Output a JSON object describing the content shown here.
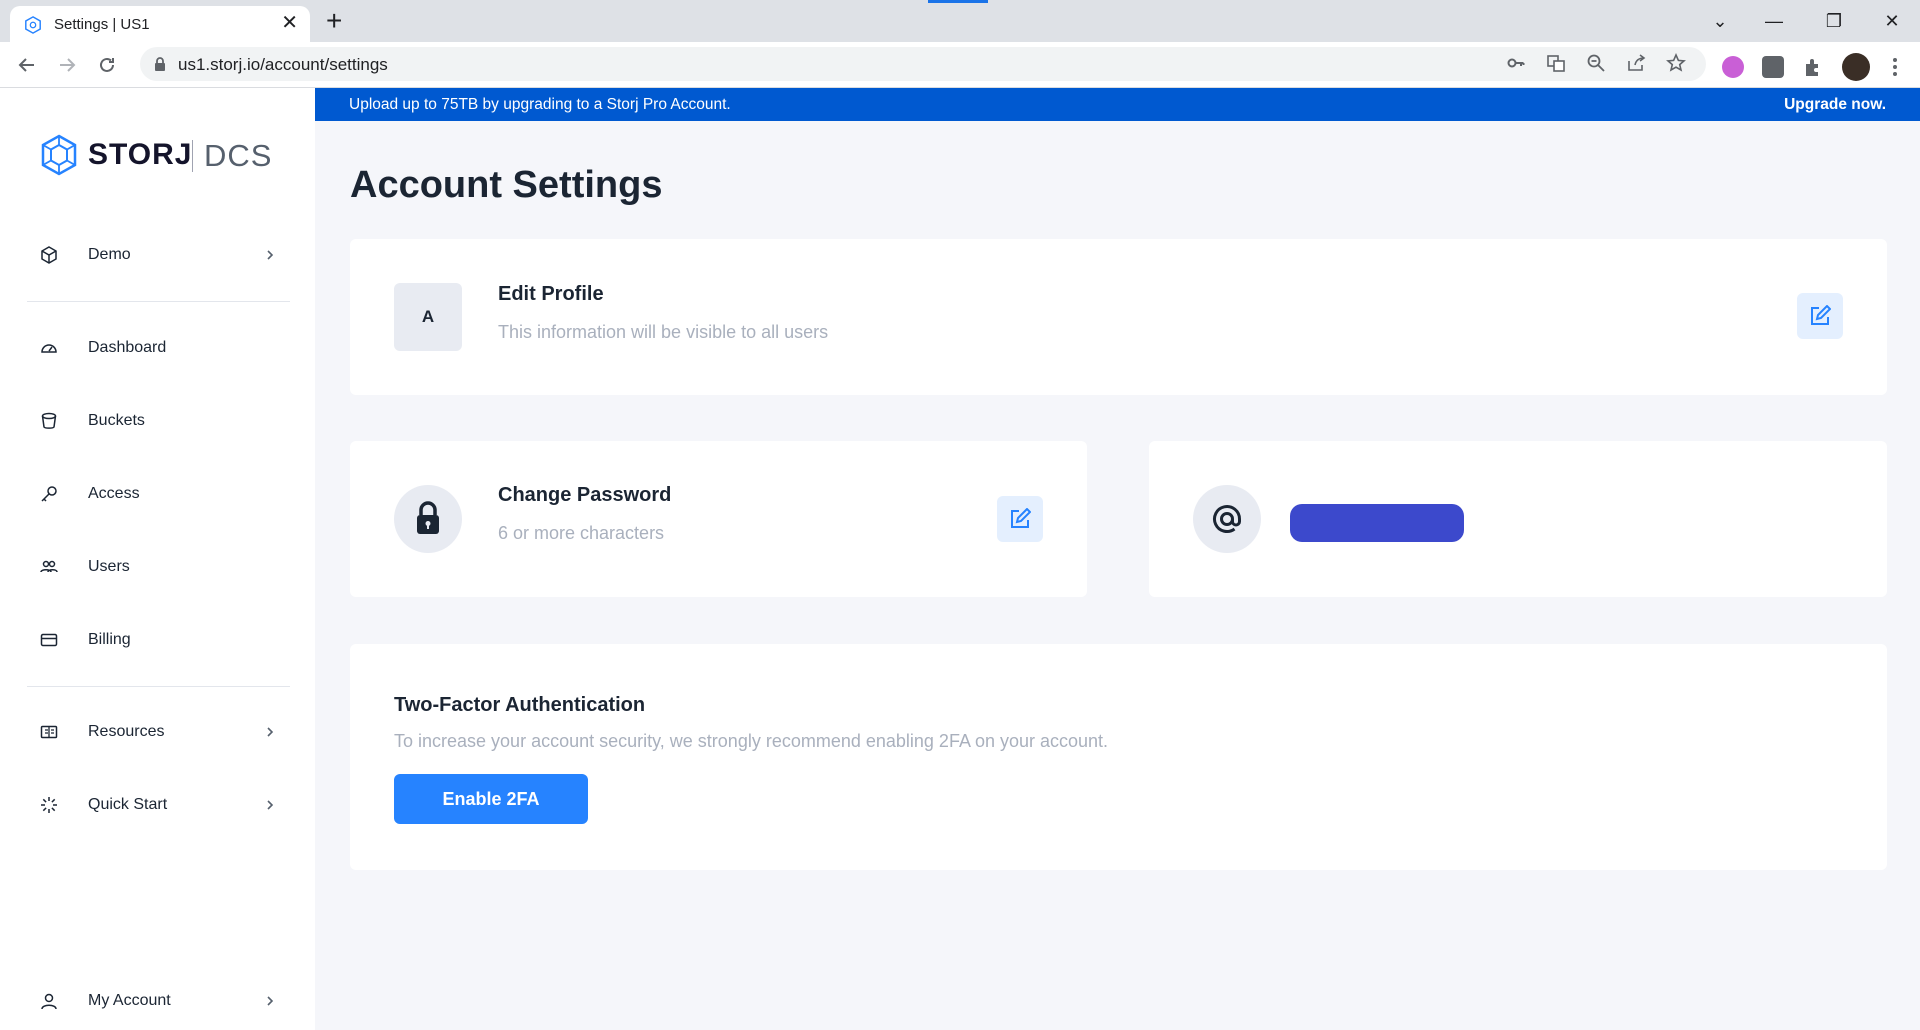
{
  "browser": {
    "tab_title": "Settings | US1",
    "tab_close": "✕",
    "new_tab": "+",
    "url": "us1.storj.io/account/settings",
    "window_controls": {
      "dropdown": "⌄",
      "minimize": "—",
      "restore": "❐",
      "close": "✕"
    }
  },
  "banner": {
    "text": "Upload up to 75TB by upgrading to a Storj Pro Account.",
    "link": "Upgrade now."
  },
  "logo": {
    "brand": "STORJ",
    "product": "DCS"
  },
  "sidebar": {
    "project": {
      "label": "Demo",
      "icon": "cube-icon"
    },
    "items": [
      {
        "label": "Dashboard",
        "icon": "gauge-icon"
      },
      {
        "label": "Buckets",
        "icon": "bucket-icon"
      },
      {
        "label": "Access",
        "icon": "key-icon"
      },
      {
        "label": "Users",
        "icon": "users-icon"
      },
      {
        "label": "Billing",
        "icon": "card-icon"
      }
    ],
    "resources": {
      "label": "Resources",
      "icon": "resources-icon"
    },
    "quick_start": {
      "label": "Quick Start",
      "icon": "sparkle-icon"
    },
    "account": {
      "label": "My Account",
      "icon": "user-icon"
    }
  },
  "page": {
    "title": "Account Settings"
  },
  "profile": {
    "avatar_letter": "A",
    "title": "Edit Profile",
    "subtitle": "This information will be visible to all users"
  },
  "password": {
    "title": "Change Password",
    "subtitle": "6 or more characters"
  },
  "email": {
    "icon": "at-icon"
  },
  "two_factor": {
    "title": "Two-Factor Authentication",
    "description": "To increase your account security, we strongly recommend enabling 2FA on your account.",
    "button": "Enable 2FA"
  },
  "colors": {
    "accent": "#2683ff",
    "banner": "#0059d0",
    "redaction": "#3c49cc",
    "text_dark": "#1b2533",
    "text_muted": "#a9b0bd",
    "background": "#f5f6fa"
  }
}
